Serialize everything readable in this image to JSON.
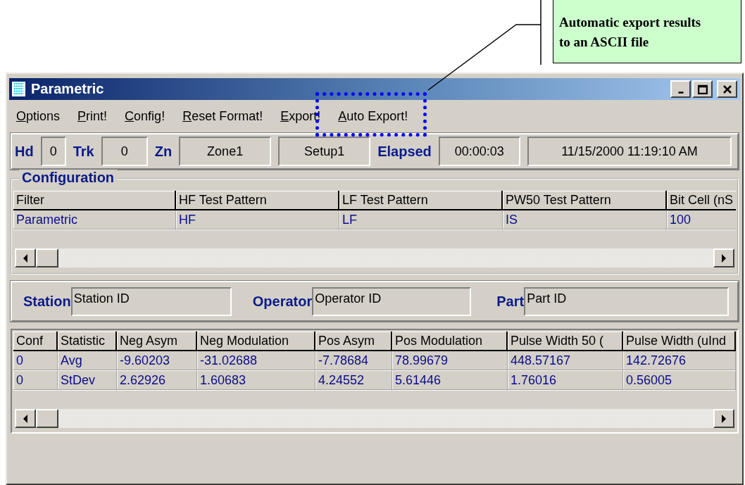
{
  "annotation": {
    "text": "Automatic export results to an ASCII file"
  },
  "window": {
    "title": "Parametric"
  },
  "menu": [
    {
      "label": "Options",
      "highlighted": false
    },
    {
      "label": "Print!",
      "highlighted": false
    },
    {
      "label": "Config!",
      "highlighted": false
    },
    {
      "label": "Reset Format!",
      "highlighted": false
    },
    {
      "label": "Export!",
      "highlighted": false
    },
    {
      "label": "Auto Export!",
      "highlighted": true
    }
  ],
  "status_row": [
    {
      "label": "Hd",
      "value": "0"
    },
    {
      "label": "Trk",
      "value": "0"
    },
    {
      "label": "Zn",
      "value": "Zone1"
    },
    {
      "value": "Setup1"
    },
    {
      "label": "Elapsed",
      "value": "00:00:03"
    },
    {
      "value": "11/15/2000 11:19:10 AM"
    }
  ],
  "configuration": {
    "title": "Configuration",
    "columns": [
      "Filter",
      "HF Test Pattern",
      "LF Test Pattern",
      "PW50 Test Pattern",
      "Bit Cell (nS"
    ],
    "rows": [
      [
        "Parametric",
        "HF",
        "LF",
        "IS",
        "100"
      ]
    ]
  },
  "identity": [
    {
      "label": "Station",
      "value": "Station ID"
    },
    {
      "label": "Operator",
      "value": "Operator ID"
    },
    {
      "label": "Part",
      "value": "Part ID"
    }
  ],
  "statistics": {
    "columns": [
      "Conf",
      "Statistic",
      "Neg Asym",
      "Neg Modulation",
      "Pos Asym",
      "Pos Modulation",
      "Pulse Width 50 (",
      "Pulse Width (uInd"
    ],
    "rows": [
      [
        "0",
        "Avg",
        "-9.60203",
        "-31.02688",
        "-7.78684",
        "78.99679",
        "448.57167",
        "142.72676"
      ],
      [
        "0",
        "StDev",
        "2.62926",
        "1.60683",
        "4.24552",
        "5.61446",
        "1.76016",
        "0.56005"
      ]
    ]
  }
}
